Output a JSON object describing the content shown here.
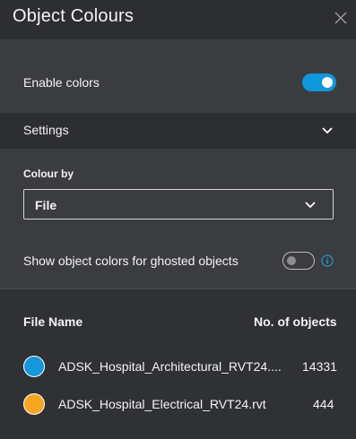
{
  "panel": {
    "title": "Object Colours"
  },
  "enable_colors": {
    "label": "Enable colors",
    "on": true
  },
  "settings": {
    "label": "Settings",
    "colour_by_label": "Colour by",
    "colour_by_value": "File",
    "ghosted_label": "Show object colors for ghosted objects",
    "ghosted_on": false
  },
  "table": {
    "col_file": "File Name",
    "col_count": "No. of objects",
    "rows": [
      {
        "name": "ADSK_Hospital_Architectural_RVT24....",
        "count": "14331",
        "color": "#1796db"
      },
      {
        "name": "ADSK_Hospital_Electrical_RVT24.rvt",
        "count": "444",
        "color": "#f5a623"
      }
    ]
  },
  "colors": {
    "accent": "#0f96dd",
    "header_bg": "#2c2e31",
    "panel_bg": "#3a3c3f"
  },
  "icons": {
    "close": "close-icon",
    "chevron": "chevron-down-icon",
    "info": "info-icon"
  }
}
